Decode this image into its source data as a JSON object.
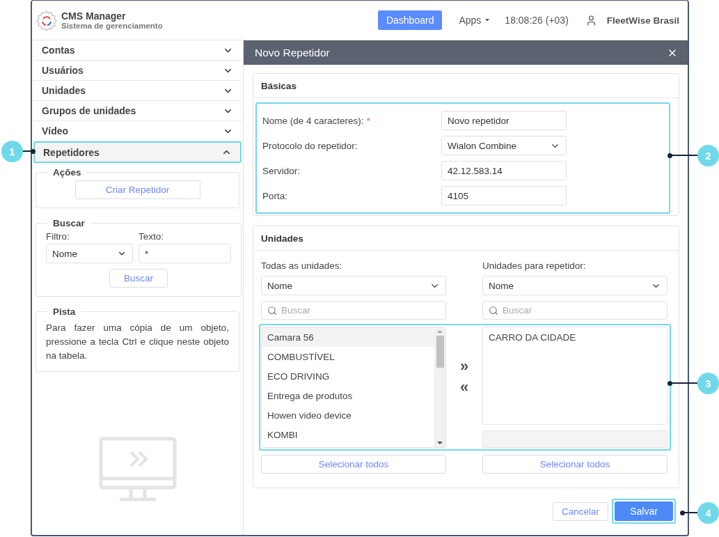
{
  "header": {
    "app_title": "CMS Manager",
    "app_subtitle": "Sistema de gerenciamento",
    "dashboard_button": "Dashboard",
    "apps_menu": "Apps",
    "clock": "18:08:26 (+03)",
    "user": "FleetWise Brasil"
  },
  "sidebar": {
    "items": [
      {
        "label": "Contas",
        "expanded": false
      },
      {
        "label": "Usuários",
        "expanded": false
      },
      {
        "label": "Unidades",
        "expanded": false
      },
      {
        "label": "Grupos de unidades",
        "expanded": false
      },
      {
        "label": "Vídeo",
        "expanded": false
      },
      {
        "label": "Repetidores",
        "expanded": true
      }
    ],
    "actions": {
      "title": "Ações",
      "button": "Criar Repetidor"
    },
    "search": {
      "title": "Buscar",
      "filter_label": "Filtro:",
      "filter_value": "Nome",
      "text_label": "Texto:",
      "text_value": "*",
      "button": "Buscar"
    },
    "hint": {
      "title": "Pista",
      "text": "Para fazer uma cópia de um objeto, pressione a tecla Ctrl e clique neste objeto na tabela."
    }
  },
  "dialog": {
    "title": "Novo Repetidor",
    "basics": {
      "title": "Básicas",
      "fields": [
        {
          "kind": "text",
          "label": "Nome (de 4 caracteres):",
          "required_mark": "*",
          "value": "Novo repetidor"
        },
        {
          "kind": "select",
          "label": "Protocolo do repetidor:",
          "value": "Wialon Combine"
        },
        {
          "kind": "text",
          "label": "Servidor:",
          "value": "42.12.583.14"
        },
        {
          "kind": "text",
          "label": "Porta:",
          "value": "4105"
        }
      ]
    },
    "units": {
      "title": "Unidades",
      "left": {
        "label": "Todas as unidades:",
        "sort": "Nome",
        "search_placeholder": "Buscar",
        "select_all": "Selecionar todos",
        "items": [
          {
            "label": "Camara 56",
            "selected": true
          },
          {
            "label": "COMBUSTÍVEL",
            "selected": false
          },
          {
            "label": "ECO DRIVING",
            "selected": false
          },
          {
            "label": "Entrega de produtos",
            "selected": false
          },
          {
            "label": "Howen video device",
            "selected": false
          },
          {
            "label": "KOMBI",
            "selected": false
          }
        ]
      },
      "move_right": "»",
      "move_left": "«",
      "right": {
        "label": "Unidades para repetidor:",
        "sort": "Nome",
        "search_placeholder": "Buscar",
        "select_all": "Selecionar todos",
        "items": [
          {
            "label": "CARRO DA CIDADE",
            "selected": false
          }
        ]
      }
    },
    "cancel_button": "Cancelar",
    "save_button": "Salvar"
  },
  "callouts": [
    "1",
    "2",
    "3",
    "4"
  ]
}
